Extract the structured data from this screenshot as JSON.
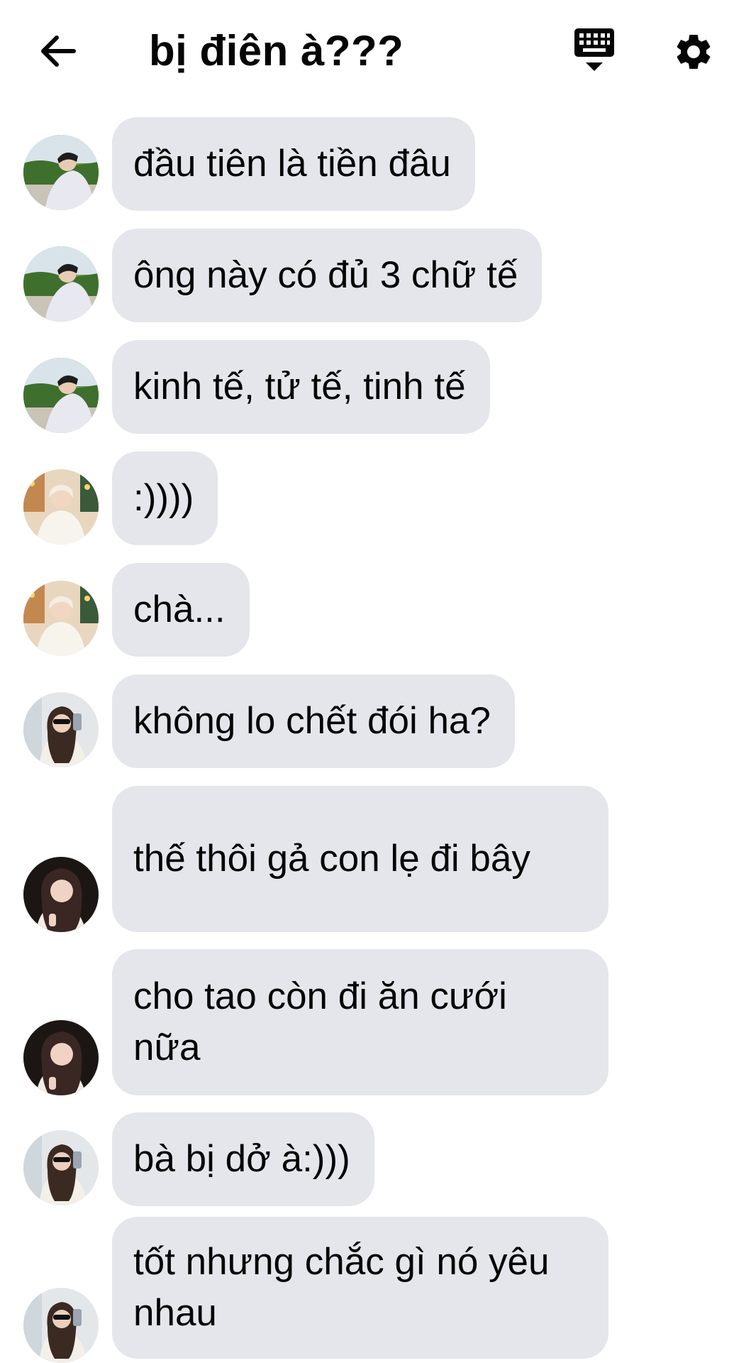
{
  "header": {
    "title": "bị điên à???",
    "back_icon": "arrow-left-icon",
    "keyboard_icon": "keyboard-icon",
    "settings_icon": "gear-icon"
  },
  "colors": {
    "bubble": "#e4e6eb",
    "text": "#050505",
    "icon": "#050505"
  },
  "messages": [
    {
      "sender": "avatar-a",
      "text": "đầu tiên là tiền đâu"
    },
    {
      "sender": "avatar-a",
      "text": "ông này có đủ 3 chữ tế"
    },
    {
      "sender": "avatar-a",
      "text": "kinh tế, tử tế, tinh tế"
    },
    {
      "sender": "avatar-b",
      "text": ":))))"
    },
    {
      "sender": "avatar-b",
      "text": "chà..."
    },
    {
      "sender": "avatar-c",
      "text": "không lo chết đói ha?"
    },
    {
      "sender": "avatar-d",
      "text": "thế thôi gả con lẹ đi bây"
    },
    {
      "sender": "avatar-d",
      "text": "cho tao còn đi ăn cưới nữa"
    },
    {
      "sender": "avatar-c",
      "text": "bà bị dở à:)))"
    },
    {
      "sender": "avatar-c",
      "text": "tốt nhưng chắc gì nó yêu nhau"
    }
  ]
}
